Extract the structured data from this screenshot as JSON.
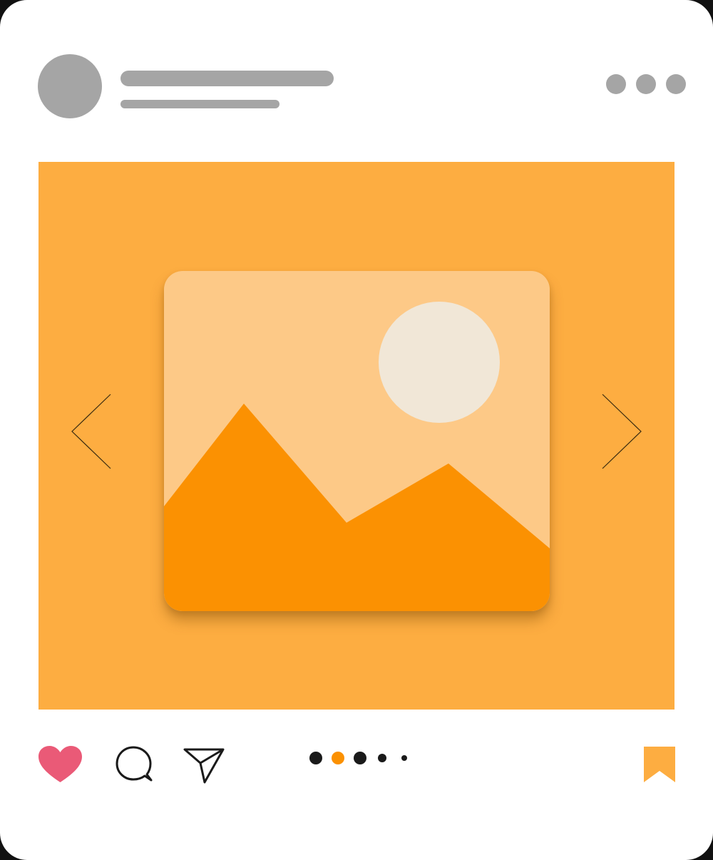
{
  "post": {
    "header": {
      "avatar_color": "#a5a5a5",
      "name_placeholder_color": "#a5a5a5",
      "more_icon": "ellipsis-horizontal-icon",
      "more_color": "#a5a5a5"
    },
    "media": {
      "background_color": "#fdad41",
      "image_icon": "image-placeholder-icon",
      "sky_color": "#fdc987",
      "sun_color": "#f1e7d7",
      "mountain_color": "#fb9102",
      "prev_icon": "chevron-left-icon",
      "next_icon": "chevron-right-icon"
    },
    "actions": {
      "like_icon": "heart-icon",
      "like_color": "#ea5a77",
      "comment_icon": "comment-bubble-icon",
      "share_icon": "paper-plane-icon",
      "save_icon": "bookmark-icon",
      "save_color": "#fdad41"
    },
    "pagination": {
      "total": 5,
      "active_index": 1,
      "active_color": "#fb9102",
      "inactive_color": "#1a1a1a"
    }
  }
}
